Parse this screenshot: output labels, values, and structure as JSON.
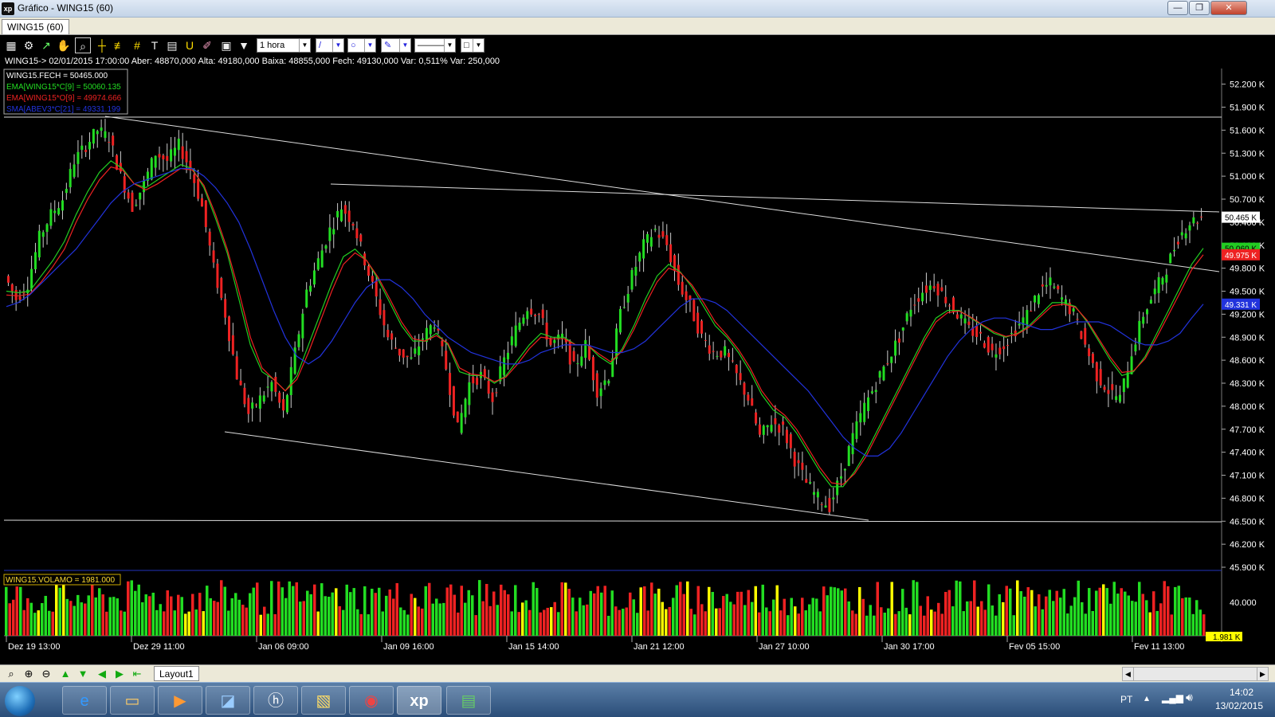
{
  "window": {
    "title": "Gráfico - WING15 (60)",
    "app_icon": "xp",
    "minimize": "—",
    "maximize": "❐",
    "close": "✕"
  },
  "tab": {
    "label": "WING15 (60)"
  },
  "toolbar": {
    "icons": [
      "chart-icon",
      "gear-icon",
      "cursor-icon",
      "hand-icon",
      "zoom-icon",
      "crosshair-icon",
      "fib-icon",
      "hash-icon",
      "text-icon",
      "magnet-icon",
      "ruler-icon",
      "calculator-icon",
      "briefcase-icon",
      "filter-icon"
    ],
    "period": "1 hora",
    "line_tool": "/",
    "shape_tool": "○",
    "pen_tool": "✎",
    "line_style": "———",
    "color_box": "□"
  },
  "info_line": "WING15-> 02/01/2015 17:00:00 Aber: 48870,000 Alta: 49180,000 Baixa: 48855,000 Fech: 49130,000 Var: 0,511% Var: 250,000",
  "legend": [
    {
      "text": "WING15.FECH = 50465.000",
      "color": "#ffffff"
    },
    {
      "text": "EMA[WING15*C[9] = 50060.135",
      "color": "#22dd22"
    },
    {
      "text": "EMA[WING15*O[9] = 49974.666",
      "color": "#ee2222"
    },
    {
      "text": "SMA[ABEV3*C[21] = 49331.199",
      "color": "#2233dd"
    }
  ],
  "volume_label": "WING15.VOLAMO = 1981.000",
  "chart_data": {
    "type": "line",
    "x_ticks": [
      "Dez 19 13:00",
      "Dez 29 11:00",
      "Jan 06 09:00",
      "Jan 09 16:00",
      "Jan 15 14:00",
      "Jan 21 12:00",
      "Jan 27 10:00",
      "Jan 30 17:00",
      "Fev 05 15:00",
      "Fev 11 13:00"
    ],
    "y_ticks": [
      "52.200 K",
      "51.900 K",
      "51.600 K",
      "51.300 K",
      "51.000 K",
      "50.700 K",
      "50.400 K",
      "50.100 K",
      "49.800 K",
      "49.500 K",
      "49.200 K",
      "48.900 K",
      "48.600 K",
      "48.300 K",
      "48.000 K",
      "47.700 K",
      "47.400 K",
      "47.100 K",
      "46.800 K",
      "46.500 K",
      "46.200 K",
      "45.900 K"
    ],
    "ylim": [
      45900,
      52300
    ],
    "price_labels": [
      {
        "text": "50.465 K",
        "value": 50465,
        "bg": "#ffffff",
        "fg": "#000000"
      },
      {
        "text": "50.060 K",
        "value": 50060,
        "bg": "#22cc22",
        "fg": "#000000"
      },
      {
        "text": "49.975 K",
        "value": 49975,
        "bg": "#ee2222",
        "fg": "#ffffff"
      },
      {
        "text": "49.331 K",
        "value": 49331,
        "bg": "#2233dd",
        "fg": "#ffffff"
      }
    ],
    "series": [
      {
        "name": "WING15.FECH",
        "values": [
          49700,
          49400,
          49600,
          50200,
          50500,
          50700,
          51200,
          51400,
          51600,
          51500,
          51000,
          50600,
          50900,
          51300,
          51200,
          51400,
          51100,
          50600,
          49800,
          49200,
          48400,
          47900,
          48100,
          48300,
          47900,
          48700,
          49500,
          49900,
          50300,
          50600,
          50400,
          49900,
          49400,
          48900,
          48700,
          48600,
          48900,
          49100,
          48500,
          47700,
          48300,
          48400,
          48100,
          48600,
          49000,
          49300,
          49200,
          48800,
          48900,
          48500,
          48800,
          48200,
          48400,
          49200,
          49700,
          50100,
          50300,
          50100,
          49600,
          49300,
          48900,
          48700,
          48700,
          48400,
          48100,
          47600,
          47800,
          47700,
          47300,
          47000,
          46800,
          46700,
          47100,
          47600,
          48000,
          48300,
          48600,
          48900,
          49300,
          49500,
          49600,
          49400,
          49200,
          49000,
          48900,
          48700,
          48800,
          49000,
          49200,
          49500,
          49600,
          49400,
          49200,
          48800,
          48400,
          48200,
          48100,
          48700,
          49200,
          49500,
          49800,
          50200,
          50400,
          50465
        ]
      },
      {
        "name": "EMA[WING15*C[9]",
        "values": [
          49500,
          49480,
          49500,
          49700,
          49900,
          50150,
          50500,
          50800,
          51050,
          51200,
          51100,
          50900,
          50850,
          50950,
          51050,
          51150,
          51100,
          50850,
          50450,
          50000,
          49400,
          48800,
          48450,
          48350,
          48200,
          48400,
          48800,
          49200,
          49600,
          49950,
          50050,
          49900,
          49650,
          49350,
          49050,
          48850,
          48850,
          48950,
          48800,
          48450,
          48400,
          48400,
          48300,
          48400,
          48600,
          48800,
          48950,
          48900,
          48900,
          48800,
          48800,
          48650,
          48550,
          48750,
          49050,
          49400,
          49700,
          49850,
          49750,
          49550,
          49300,
          49050,
          48900,
          48700,
          48450,
          48150,
          47950,
          47850,
          47650,
          47400,
          47150,
          46950,
          46950,
          47150,
          47400,
          47700,
          48000,
          48300,
          48600,
          48900,
          49150,
          49250,
          49250,
          49150,
          49050,
          48950,
          48900,
          48950,
          49050,
          49200,
          49350,
          49350,
          49300,
          49100,
          48850,
          48600,
          48400,
          48450,
          48650,
          48950,
          49250,
          49550,
          49850,
          50060
        ]
      },
      {
        "name": "EMA[WING15*O[9]",
        "values": [
          49450,
          49440,
          49460,
          49620,
          49820,
          50050,
          50400,
          50700,
          50950,
          51120,
          51080,
          50900,
          50820,
          50900,
          51000,
          51100,
          51080,
          50880,
          50500,
          50050,
          49500,
          48900,
          48500,
          48350,
          48200,
          48350,
          48700,
          49100,
          49500,
          49850,
          50000,
          49900,
          49680,
          49400,
          49100,
          48880,
          48850,
          48920,
          48820,
          48500,
          48420,
          48400,
          48320,
          48380,
          48550,
          48750,
          48900,
          48880,
          48880,
          48800,
          48800,
          48680,
          48580,
          48720,
          49000,
          49330,
          49620,
          49800,
          49740,
          49580,
          49350,
          49100,
          48930,
          48740,
          48500,
          48200,
          48000,
          47880,
          47700,
          47450,
          47200,
          47000,
          46980,
          47120,
          47350,
          47650,
          47950,
          48250,
          48550,
          48850,
          49100,
          49220,
          49240,
          49160,
          49060,
          48970,
          48910,
          48940,
          49030,
          49170,
          49310,
          49330,
          49290,
          49120,
          48880,
          48640,
          48440,
          48460,
          48620,
          48900,
          49190,
          49480,
          49780,
          49975
        ]
      },
      {
        "name": "SMA[ABEV3*C[21]",
        "values": [
          49300,
          49350,
          49450,
          49600,
          49750,
          49900,
          50050,
          50250,
          50450,
          50650,
          50800,
          50900,
          50950,
          51000,
          51050,
          51100,
          51100,
          51000,
          50850,
          50650,
          50400,
          50050,
          49650,
          49250,
          48900,
          48650,
          48550,
          48650,
          48850,
          49100,
          49350,
          49550,
          49650,
          49650,
          49550,
          49400,
          49200,
          49050,
          48900,
          48800,
          48700,
          48650,
          48600,
          48550,
          48550,
          48600,
          48700,
          48750,
          48800,
          48800,
          48800,
          48750,
          48700,
          48700,
          48750,
          48850,
          49000,
          49150,
          49300,
          49400,
          49400,
          49350,
          49250,
          49100,
          48950,
          48800,
          48650,
          48500,
          48350,
          48200,
          48000,
          47800,
          47600,
          47450,
          47350,
          47350,
          47450,
          47650,
          47900,
          48150,
          48400,
          48650,
          48850,
          49000,
          49100,
          49150,
          49150,
          49100,
          49050,
          49000,
          49000,
          49050,
          49100,
          49100,
          49100,
          49050,
          48950,
          48850,
          48800,
          48800,
          48850,
          48950,
          49150,
          49331
        ]
      }
    ],
    "volume": {
      "current": "1.981 K",
      "ref_tick": "40.000"
    }
  },
  "bottom_bar": {
    "layout_tab": "Layout1",
    "icons": [
      "magnifier-icon",
      "zoom-in-icon",
      "zoom-out-icon",
      "arrow-up-icon",
      "arrow-down-icon",
      "arrow-left-icon",
      "arrow-right-icon",
      "arrow-home-icon"
    ]
  },
  "taskbar": {
    "apps": [
      "ie-icon",
      "explorer-icon",
      "media-player-icon",
      "monitor-app-icon",
      "hp-icon",
      "archive-icon",
      "chrome-icon",
      "xp-icon",
      "chart-app-icon"
    ],
    "xp_label": "xp",
    "lang": "PT",
    "time": "14:02",
    "date": "13/02/2015"
  }
}
